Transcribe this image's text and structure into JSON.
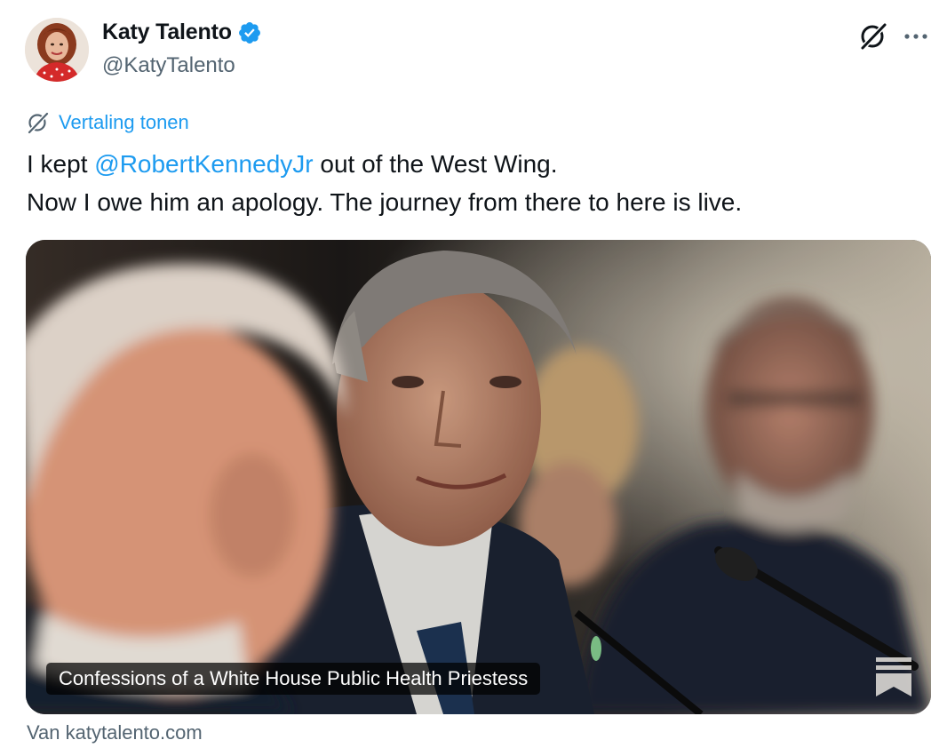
{
  "author": {
    "display_name": "Katy Talento",
    "handle": "@KatyTalento",
    "avatar_icon": "profile-photo",
    "verified_icon": "verified-badge-icon"
  },
  "actions": {
    "grok_icon": "grok-icon",
    "more_icon": "more-dots-icon"
  },
  "translate": {
    "icon": "translate-icon",
    "label": "Vertaling tonen"
  },
  "tweet": {
    "line1_pre": "I kept ",
    "mention": "@RobertKennedyJr",
    "line1_post": " out of the West Wing.",
    "line2": "Now I owe him an apology. The journey from there to here is live."
  },
  "card": {
    "title": "Confessions of a White House Public Health Priestess",
    "logo_icon": "substack-bookmark-icon",
    "source": "Van katytalento.com"
  },
  "colors": {
    "accent": "#1d9bf0",
    "text": "#0f1419",
    "muted": "#536471"
  }
}
